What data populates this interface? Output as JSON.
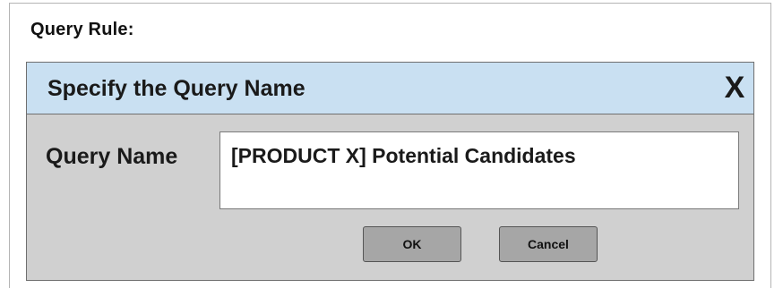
{
  "page": {
    "rule_label": "Query Rule:"
  },
  "dialog": {
    "title": "Specify the Query Name",
    "close_label": "X",
    "field_label": "Query Name",
    "field_value": "[PRODUCT X] Potential Candidates",
    "ok_label": "OK",
    "cancel_label": "Cancel"
  },
  "colors": {
    "titlebar": "#c9e0f2",
    "dialog_body": "#d0d0d0",
    "button": "#a6a6a6"
  }
}
